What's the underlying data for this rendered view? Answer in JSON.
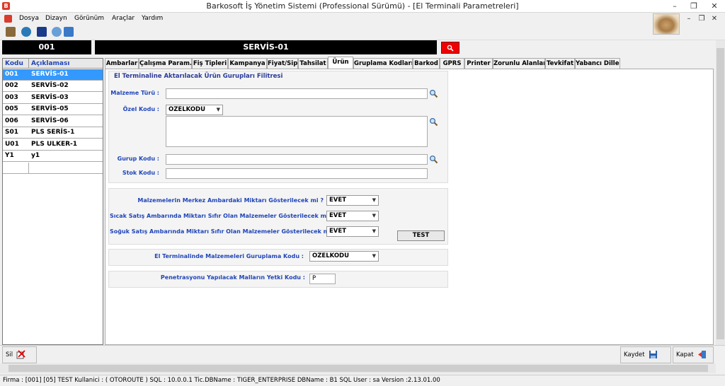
{
  "window": {
    "title": "Barkosoft İş Yönetim Sistemi (Professional Sürümü) - [El Terminali Parametreleri]",
    "minimize": "–",
    "restore": "❐",
    "close": "✕"
  },
  "menu": [
    "Dosya",
    "Dizayn",
    "Görünüm",
    "Araçlar",
    "Yardım"
  ],
  "mdi_controls": {
    "minimize": "–",
    "restore": "❐",
    "close": "✕"
  },
  "header": {
    "code": "001",
    "name": "SERVİS-01"
  },
  "list": {
    "col_code": "Kodu",
    "col_desc": "Açıklaması",
    "rows": [
      {
        "code": "001",
        "desc": "SERVİS-01",
        "selected": true
      },
      {
        "code": "002",
        "desc": "SERVİS-02"
      },
      {
        "code": "003",
        "desc": "SERVİS-03"
      },
      {
        "code": "005",
        "desc": "SERVİS-05"
      },
      {
        "code": "006",
        "desc": "SERVİS-06"
      },
      {
        "code": "S01",
        "desc": "PLS SERİS-1"
      },
      {
        "code": "U01",
        "desc": "PLS ULKER-1"
      },
      {
        "code": "Y1",
        "desc": "y1"
      },
      {
        "code": "",
        "desc": ""
      }
    ]
  },
  "tabs": [
    "Ambarlar",
    "Çalışma Param.",
    "Fiş Tipleri",
    "Kampanya",
    "Fiyat/Sip",
    "Tahsilat",
    "Ürün",
    "Gruplama Kodları",
    "Barkod",
    "GPRS",
    "Printer",
    "Zorunlu Alanlar",
    "Tevkifat",
    "Yabancı Diller"
  ],
  "active_tab": "Ürün",
  "filter_group": {
    "title": "El Terminaline Aktarılacak Ürün Gurupları Filitresi",
    "malzeme_turu_label": "Malzeme Türü :",
    "malzeme_turu_value": "",
    "ozel_kodu_label": "Özel Kodu :",
    "ozel_kodu_select": "OZELKODU",
    "ozel_kodu_text": "",
    "gurup_kodu_label": "Gurup Kodu :",
    "gurup_kodu_value": "",
    "stok_kodu_label": "Stok Kodu :",
    "stok_kodu_value": ""
  },
  "options_group": {
    "q1_label": "Malzemelerin Merkez Ambardaki Miktarı Gösterilecek mi ?",
    "q1_value": "EVET",
    "q2_label": "Sıcak Satış Ambarında Miktarı Sıfır Olan Malzemeler Gösterilecek mi ?",
    "q2_value": "EVET",
    "q3_label": "Soğuk Satış Ambarında Miktarı Sıfır Olan Malzemeler Gösterilecek mi ?",
    "q3_value": "EVET",
    "test_label": "TEST"
  },
  "grouping": {
    "label": "El Terminalinde Malzemeleri Guruplama Kodu :",
    "value": "OZELKODU"
  },
  "penetration": {
    "label": "Penetrasyonu Yapılacak Malların Yetki Kodu :",
    "value": "P"
  },
  "bottom": {
    "delete_label": "Sil",
    "save_label": "Kaydet",
    "close_label": "Kapat"
  },
  "status": "Firma : [001] [05]  TEST    Kullanici : ( OTOROUTE )    SQL : 10.0.0.1    Tic.DBName : TIGER_ENTERPRISE    DBName : B1    SQL User : sa   Version :2.13.01.00",
  "icons": [
    "app-logo-icon",
    "search-icon",
    "dropdown-arrow-icon",
    "save-icon",
    "exit-icon",
    "delete-icon"
  ]
}
